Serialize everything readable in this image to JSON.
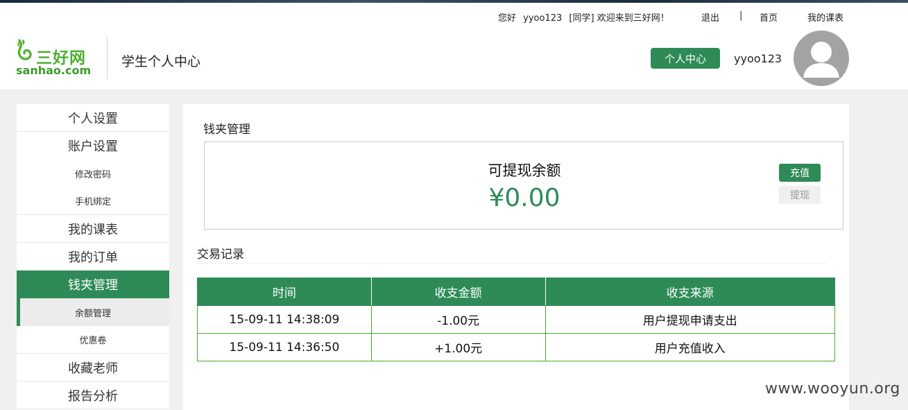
{
  "header": {
    "greeting": "您好",
    "user": "yyoo123",
    "role": "[同学]",
    "welcome": "欢迎来到三好网！",
    "logout": "退出",
    "separator": "|",
    "home": "首页",
    "my_schedule": "我的课表",
    "logo_cn": "三好网",
    "logo_en": "sanhao.com",
    "center_title": "学生个人中心",
    "center_button": "个人中心",
    "username": "yyoo123"
  },
  "sidebar": {
    "items": [
      {
        "label": "个人设置"
      },
      {
        "label": "账户设置"
      },
      {
        "label": "修改密码"
      },
      {
        "label": "手机绑定"
      },
      {
        "label": "我的课表"
      },
      {
        "label": "我的订单"
      },
      {
        "label": "钱夹管理"
      },
      {
        "label": "余额管理"
      },
      {
        "label": "优惠卷"
      },
      {
        "label": "收藏老师"
      },
      {
        "label": "报告分析"
      }
    ]
  },
  "wallet": {
    "title": "钱夹管理",
    "balance_label": "可提现余额",
    "balance_amount": "¥0.00",
    "recharge": "充值",
    "withdraw": "提现"
  },
  "transactions": {
    "title": "交易记录",
    "columns": [
      "时间",
      "收支金额",
      "收支来源"
    ],
    "rows": [
      [
        "15-09-11 14:38:09",
        "-1.00元",
        "用户提现申请支出"
      ],
      [
        "15-09-11 14:36:50",
        "+1.00元",
        "用户充值收入"
      ]
    ]
  },
  "watermark": "www.wooyun.org",
  "colors": {
    "accent": "#2e8b57",
    "logo_green": "#4caf2f",
    "avatar_gray": "#a3a3a3"
  }
}
